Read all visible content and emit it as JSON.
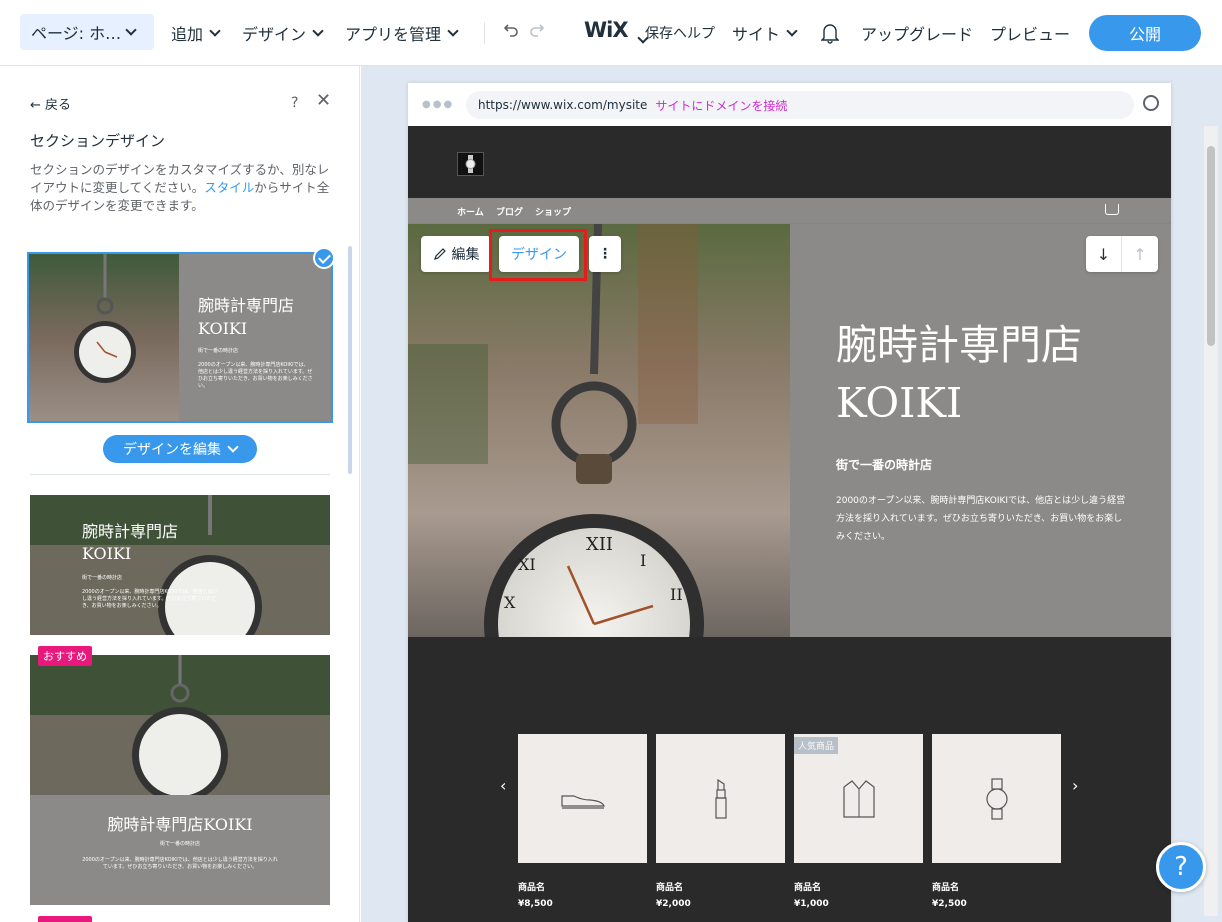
{
  "topbar": {
    "page_selector": "ページ: ホ…",
    "menu": [
      "追加",
      "デザイン",
      "アプリを管理"
    ],
    "logo": "WiX",
    "save_help": "保存ヘルプ",
    "site": "サイト",
    "upgrade": "アップグレード",
    "preview": "プレビュー",
    "publish": "公開"
  },
  "panel": {
    "back": "戻る",
    "help": "?",
    "title": "セクションデザイン",
    "desc_pre": "セクションのデザインをカスタマイズするか、別なレイアウトに変更してください。",
    "desc_link": "スタイル",
    "desc_post": "からサイト全体のデザインを変更できます。",
    "edit_design": "デザインを編集",
    "badge": "おすすめ",
    "thumbs": [
      {
        "title_l1": "腕時計専門店",
        "title_l2": "KOIKI",
        "sub": "街で一番の時計店",
        "body": "2000のオープン以来、腕時計専門店KOIKIでは、他店とは少し違う経営方法を採り入れています。ぜひお立ち寄りいただき、お買い物をお楽しみください。"
      },
      {
        "title_l1": "腕時計専門店",
        "title_l2": "KOIKI",
        "sub": "街で一番の時計店",
        "body": "2000のオープン以来、腕時計専門店KOIKIでは、他店とは少し違う経営方法を採り入れています。ぜひお立ち寄りいただき、お買い物をお楽しみください。"
      },
      {
        "title_l1": "腕時計専門店KOIKI",
        "sub": "街で一番の時計店",
        "body": "2000のオープン以来、腕時計専門店KOIKIでは、他店とは少し違う経営方法を採り入れています。ぜひお立ち寄りいただき、お買い物をお楽しみください。"
      }
    ]
  },
  "browser": {
    "url": "https://www.wix.com/mysite",
    "connect_domain": "サイトにドメインを接続"
  },
  "site": {
    "nav": [
      "ホーム",
      "ブログ",
      "ショップ"
    ],
    "hero": {
      "title_l1": "腕時計専門店",
      "title_l2": "KOIKI",
      "subtitle": "街で一番の時計店",
      "body": "2000のオープン以来、腕時計専門店KOIKIでは、他店とは少し違う経営方法を採り入れています。ぜひお立ち寄りいただき、お買い物をお楽しみください。"
    },
    "toolbar": {
      "edit": "編集",
      "design": "デザイン"
    },
    "popular_badge": "人気商品",
    "products": [
      {
        "name": "商品名",
        "price": "¥8,500",
        "icon": "shoe-icon"
      },
      {
        "name": "商品名",
        "price": "¥2,000",
        "icon": "lipstick-icon"
      },
      {
        "name": "商品名",
        "price": "¥1,000",
        "icon": "shirt-icon"
      },
      {
        "name": "商品名",
        "price": "¥2,500",
        "icon": "watch-icon"
      }
    ]
  },
  "help_fab": "?",
  "colors": {
    "accent": "#3899ec",
    "highlight": "#e51c1c",
    "badge": "#e8187c",
    "hero_bg": "#8c8a89",
    "site_bg": "#2a2a2a"
  }
}
